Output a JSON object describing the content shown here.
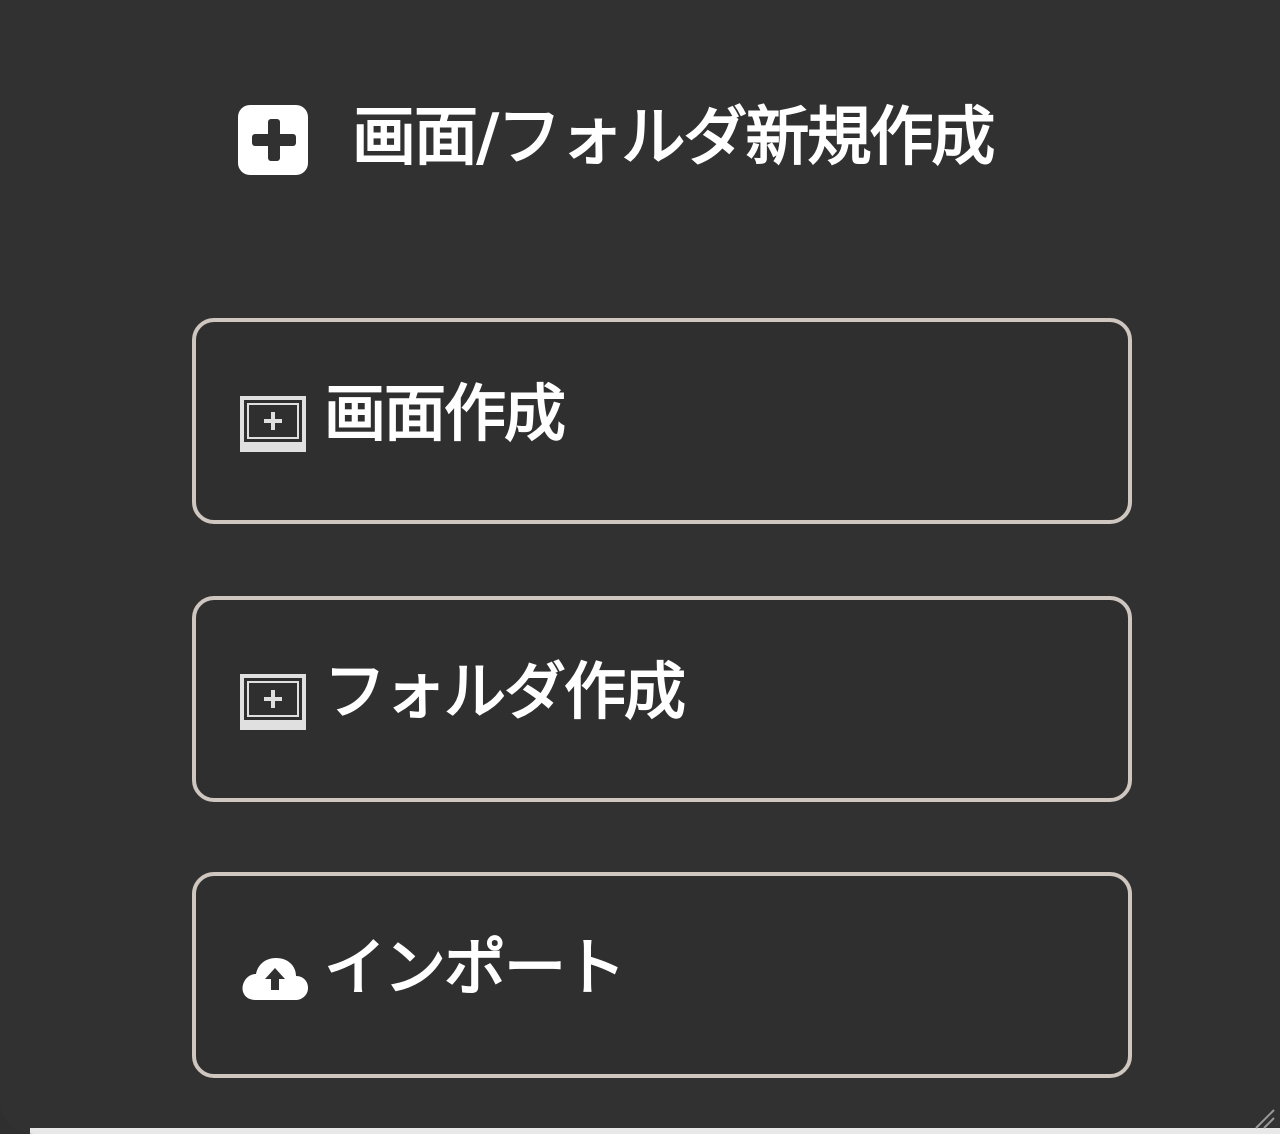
{
  "header": {
    "icon": "plus-square-icon",
    "title": "画面/フォルダ新規作成"
  },
  "actions": [
    {
      "icon": "screen-icon",
      "label": "画面作成"
    },
    {
      "icon": "screen-icon",
      "label": "フォルダ作成"
    },
    {
      "icon": "cloud-upload-icon",
      "label": "インポート"
    }
  ],
  "colors": {
    "panel_background": "#313131",
    "button_border": "#cfc6bf",
    "text": "#ffffff"
  }
}
